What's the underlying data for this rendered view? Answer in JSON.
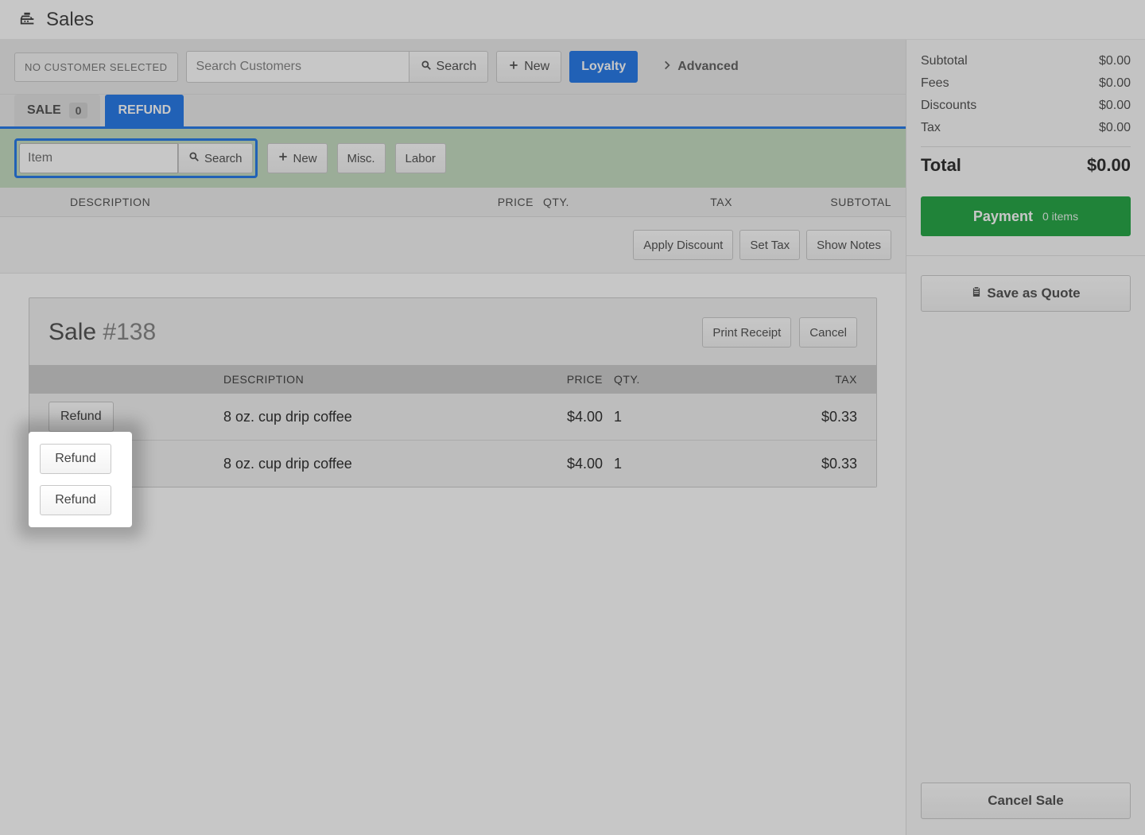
{
  "title": "Sales",
  "toolbar": {
    "no_customer": "NO CUSTOMER SELECTED",
    "search_placeholder": "Search Customers",
    "search_btn": "Search",
    "new_btn": "New",
    "loyalty_btn": "Loyalty",
    "advanced_link": "Advanced"
  },
  "tabs": {
    "sale_label": "SALE",
    "sale_count": "0",
    "refund_label": "REFUND"
  },
  "itembar": {
    "item_placeholder": "Item",
    "search_btn": "Search",
    "new_btn": "New",
    "misc_btn": "Misc.",
    "labor_btn": "Labor"
  },
  "colhdr": {
    "description": "DESCRIPTION",
    "price": "PRICE",
    "qty": "QTY.",
    "tax": "TAX",
    "subtotal": "SUBTOTAL"
  },
  "row_actions": {
    "apply_discount": "Apply Discount",
    "set_tax": "Set Tax",
    "show_notes": "Show Notes"
  },
  "sale": {
    "title_prefix": "Sale ",
    "title_number": "#138",
    "print_receipt": "Print Receipt",
    "cancel": "Cancel",
    "colhdr": {
      "description": "DESCRIPTION",
      "price": "PRICE",
      "qty": "QTY.",
      "tax": "TAX"
    },
    "refund_label": "Refund",
    "lines": [
      {
        "description": "8 oz. cup drip coffee",
        "price": "$4.00",
        "qty": "1",
        "tax": "$0.33"
      },
      {
        "description": "8 oz. cup drip coffee",
        "price": "$4.00",
        "qty": "1",
        "tax": "$0.33"
      }
    ]
  },
  "right": {
    "subtotal_label": "Subtotal",
    "subtotal_value": "$0.00",
    "fees_label": "Fees",
    "fees_value": "$0.00",
    "discounts_label": "Discounts",
    "discounts_value": "$0.00",
    "tax_label": "Tax",
    "tax_value": "$0.00",
    "total_label": "Total",
    "total_value": "$0.00",
    "payment_label": "Payment",
    "payment_sub": "0 items",
    "save_quote": "Save as Quote",
    "cancel_sale": "Cancel Sale"
  }
}
